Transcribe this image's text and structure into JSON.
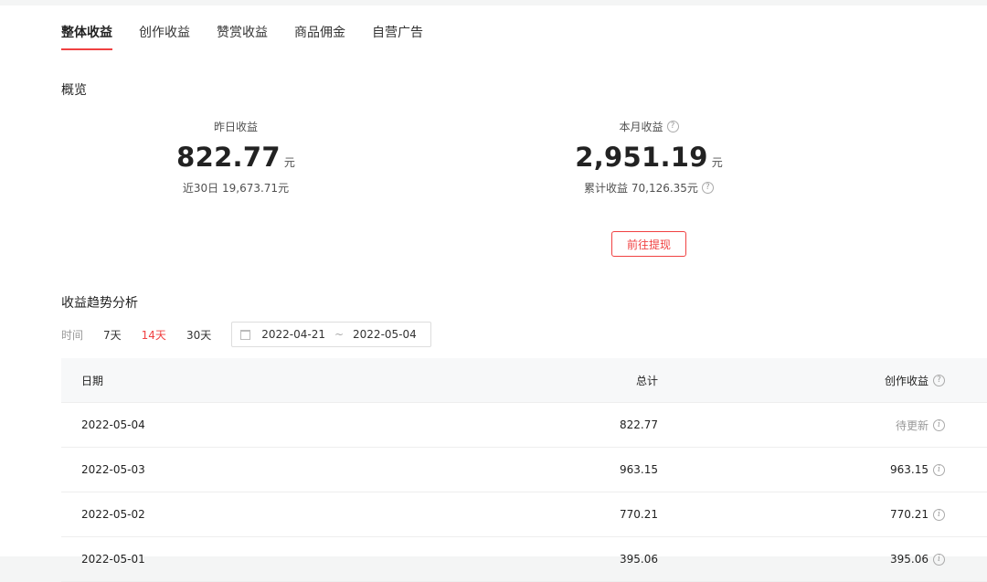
{
  "tabs": [
    {
      "label": "整体收益",
      "active": true
    },
    {
      "label": "创作收益",
      "active": false
    },
    {
      "label": "赞赏收益",
      "active": false
    },
    {
      "label": "商品佣金",
      "active": false
    },
    {
      "label": "自营广告",
      "active": false
    }
  ],
  "overview": {
    "title": "概览",
    "yesterday": {
      "label": "昨日收益",
      "value": "822.77",
      "unit": "元",
      "sub": "近30日 19,673.71元"
    },
    "month": {
      "label": "本月收益",
      "value": "2,951.19",
      "unit": "元",
      "sub": "累计收益 70,126.35元"
    },
    "withdraw_label": "前往提现"
  },
  "trend": {
    "title": "收益趋势分析",
    "time_label": "时间",
    "options": [
      {
        "label": "7天",
        "active": false
      },
      {
        "label": "14天",
        "active": true
      },
      {
        "label": "30天",
        "active": false
      }
    ],
    "date_start": "2022-04-21",
    "date_sep": "~",
    "date_end": "2022-05-04"
  },
  "table": {
    "headers": {
      "date": "日期",
      "total": "总计",
      "creation": "创作收益"
    },
    "rows": [
      {
        "date": "2022-05-04",
        "total": "822.77",
        "creation": "待更新"
      },
      {
        "date": "2022-05-03",
        "total": "963.15",
        "creation": "963.15"
      },
      {
        "date": "2022-05-02",
        "total": "770.21",
        "creation": "770.21"
      },
      {
        "date": "2022-05-01",
        "total": "395.06",
        "creation": "395.06"
      }
    ]
  },
  "colors": {
    "accent": "#f04142",
    "muted_text": "#999999",
    "header_bg": "#f7f8f9"
  }
}
